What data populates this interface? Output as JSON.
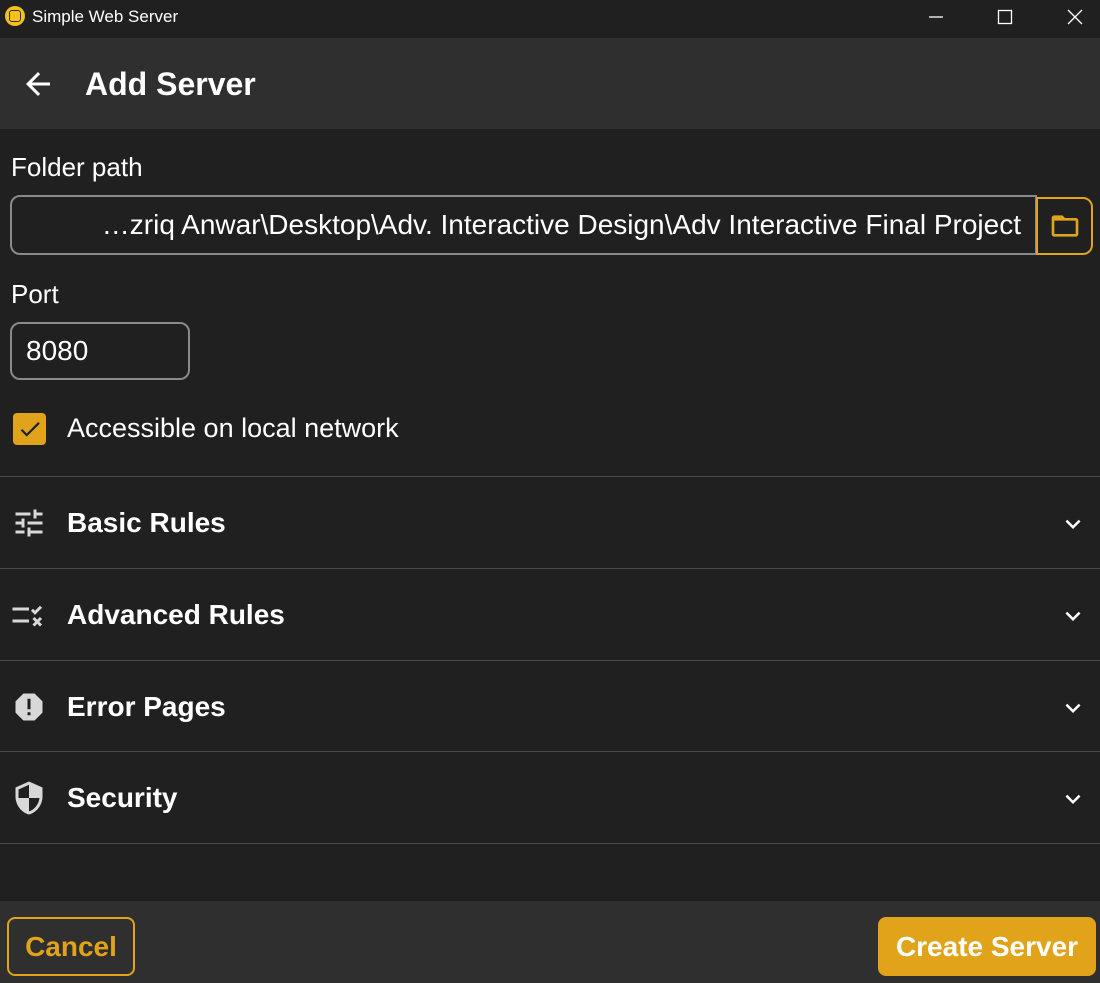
{
  "window": {
    "title": "Simple Web Server",
    "icons": {
      "app": "app-logo-icon",
      "minimize": "minimize-icon",
      "maximize": "maximize-icon",
      "close": "close-icon"
    }
  },
  "header": {
    "title": "Add Server",
    "back_icon": "arrow-left-icon"
  },
  "form": {
    "folder_path_label": "Folder path",
    "folder_path_value": "…zriq Anwar\\Desktop\\Adv. Interactive Design\\Adv Interactive Final Project",
    "folder_browse_icon": "folder-icon",
    "port_label": "Port",
    "port_value": "8080",
    "local_network_label": "Accessible on local network",
    "local_network_checked": true
  },
  "sections": [
    {
      "label": "Basic Rules",
      "icon": "sliders-icon"
    },
    {
      "label": "Advanced Rules",
      "icon": "rules-check-cross-icon"
    },
    {
      "label": "Error Pages",
      "icon": "alert-octagon-icon"
    },
    {
      "label": "Security",
      "icon": "shield-icon"
    }
  ],
  "footer": {
    "cancel_label": "Cancel",
    "create_label": "Create Server"
  },
  "colors": {
    "accent": "#e0a31a",
    "background": "#202020",
    "header_bg": "#2f2f2f",
    "divider": "#4a4a4a"
  }
}
